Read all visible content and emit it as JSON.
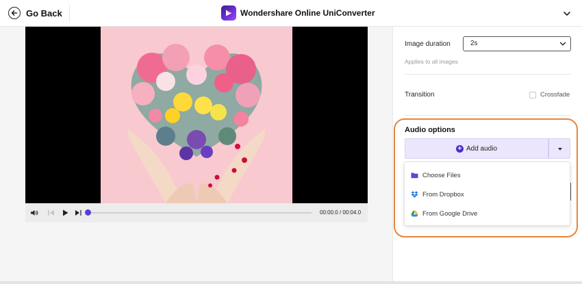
{
  "header": {
    "back_label": "Go Back",
    "app_title": "Wondershare Online UniConverter"
  },
  "player": {
    "time_current": "00:00.0",
    "time_separator": "/",
    "time_total": "00:04.0",
    "progress_fraction": 0.0
  },
  "settings": {
    "image_duration_label": "Image duration",
    "image_duration_value": "2s",
    "image_duration_hint": "Applies to all images",
    "transition_label": "Transition",
    "crossfade_label": "Crossfade",
    "crossfade_checked": false
  },
  "audio": {
    "title": "Audio options",
    "add_label": "Add audio",
    "menu": [
      {
        "label": "Choose Files",
        "icon": "folder-icon"
      },
      {
        "label": "From Dropbox",
        "icon": "dropbox-icon"
      },
      {
        "label": "From Google Drive",
        "icon": "google-drive-icon"
      }
    ]
  },
  "colors": {
    "accent": "#4b2fd0",
    "highlight_outline": "#e8843a",
    "button_bg": "#ebe6fb"
  }
}
